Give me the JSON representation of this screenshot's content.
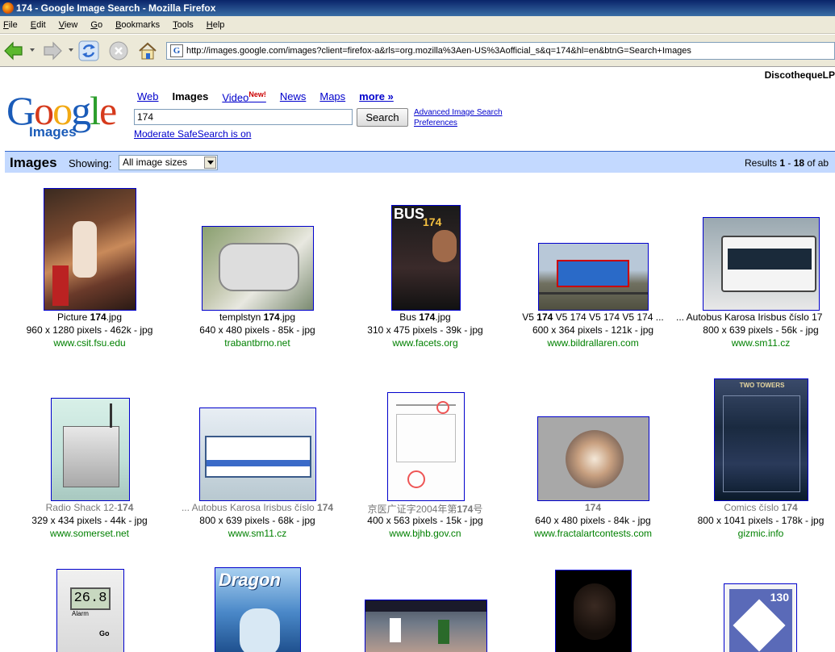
{
  "window": {
    "title": "174 - Google Image Search - Mozilla Firefox"
  },
  "menu": [
    "File",
    "Edit",
    "View",
    "Go",
    "Bookmarks",
    "Tools",
    "Help"
  ],
  "address": "http://images.google.com/images?client=firefox-a&rls=org.mozilla%3Aen-US%3Aofficial_s&q=174&hl=en&btnG=Search+Images",
  "account": "DiscothequeLP",
  "logo": {
    "word": "Google",
    "sub": "Images",
    "colors": [
      "#1a5bb8",
      "#d63a1c",
      "#f2a913",
      "#1a5bb8",
      "#2c9e2c",
      "#d63a1c"
    ]
  },
  "tabs": {
    "web": "Web",
    "images": "Images",
    "video": "Video",
    "video_badge": "New!",
    "news": "News",
    "maps": "Maps",
    "more": "more »"
  },
  "search": {
    "query": "174",
    "button": "Search",
    "advanced": "Advanced Image Search",
    "preferences": "Preferences",
    "safesearch": "Moderate SafeSearch is on"
  },
  "results": {
    "heading": "Images",
    "showing": "Showing:",
    "size_option": "All image sizes",
    "count_prefix": "Results ",
    "from": "1",
    "sep": " - ",
    "to": "18",
    "suffix": " of ab"
  },
  "rows": [
    [
      {
        "caption_pre": "Picture ",
        "caption_bold": "174",
        "caption_post": ".jpg",
        "meta": "960 x 1280 pixels - 462k - jpg",
        "site": "www.csit.fsu.edu"
      },
      {
        "caption_pre": "templstyn ",
        "caption_bold": "174",
        "caption_post": ".jpg",
        "meta": "640 x 480 pixels - 85k - jpg",
        "site": "trabantbrno.net"
      },
      {
        "caption_pre": "Bus ",
        "caption_bold": "174",
        "caption_post": ".jpg",
        "meta": "310 x 475 pixels - 39k - jpg",
        "site": "www.facets.org"
      },
      {
        "caption_pre": "V5 ",
        "caption_bold": "174",
        "caption_post": " V5 174 V5 174 V5 174 ...",
        "meta": "600 x 364 pixels - 121k - jpg",
        "site": "www.bildrallaren.com"
      },
      {
        "caption_pre": "... Autobus Karosa Irisbus číslo 17",
        "caption_bold": "",
        "caption_post": "",
        "meta": "800 x 639 pixels - 56k - jpg",
        "site": "www.sm11.cz"
      }
    ],
    [
      {
        "caption_pre": "Radio Shack 12-",
        "caption_bold": "174",
        "caption_post": "",
        "meta": "329 x 434 pixels - 44k - jpg",
        "site": "www.somerset.net"
      },
      {
        "caption_pre": "... Autobus Karosa Irisbus číslo ",
        "caption_bold": "174",
        "caption_post": "",
        "meta": "800 x 639 pixels - 68k - jpg",
        "site": "www.sm11.cz"
      },
      {
        "caption_pre": "京医广证字2004年第",
        "caption_bold": "174",
        "caption_post": "号",
        "meta": "400 x 563 pixels - 15k - jpg",
        "site": "www.bjhb.gov.cn"
      },
      {
        "caption_pre": "",
        "caption_bold": "174",
        "caption_post": "",
        "meta": "640 x 480 pixels - 84k - jpg",
        "site": "www.fractalartcontests.com"
      },
      {
        "caption_pre": "Comics číslo ",
        "caption_bold": "174",
        "caption_post": "",
        "meta": "800 x 1041 pixels - 178k - jpg",
        "site": "gizmic.info"
      }
    ]
  ],
  "thumb_text": {
    "bus": "BUS",
    "bus_num": "174",
    "dragon": "Dragon",
    "therm": "26.8",
    "therm_label": "Alarm",
    "therm_go": "Go",
    "stamp": "130",
    "two_towers": "TWO TOWERS"
  }
}
